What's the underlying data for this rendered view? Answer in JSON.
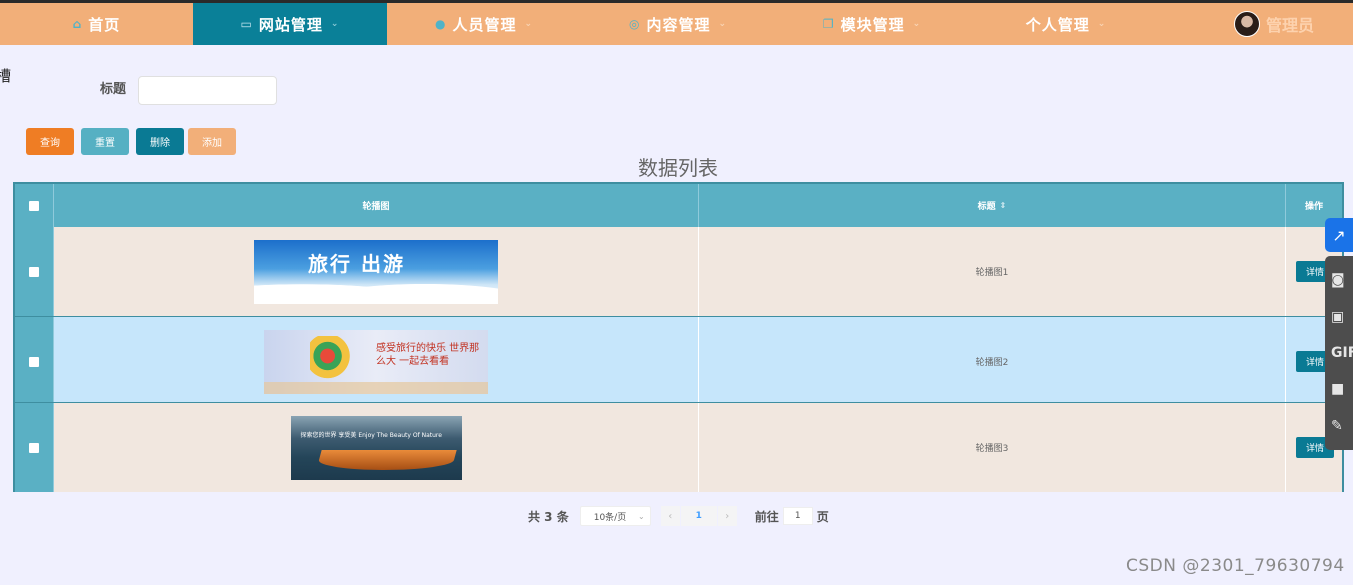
{
  "nav": {
    "items": [
      {
        "label": "首页",
        "icon": "home-icon",
        "glyph": "⌂",
        "caret": ""
      },
      {
        "label": "网站管理",
        "icon": "monitor-icon",
        "glyph": "▭",
        "caret": "⌄"
      },
      {
        "label": "人员管理",
        "icon": "user-icon",
        "glyph": "●",
        "caret": "⌄"
      },
      {
        "label": "内容管理",
        "icon": "chat-icon",
        "glyph": "◎",
        "caret": "⌄"
      },
      {
        "label": "模块管理",
        "icon": "copy-icon",
        "glyph": "❐",
        "caret": "⌄"
      },
      {
        "label": "个人管理",
        "icon": "",
        "glyph": "",
        "caret": "⌄"
      }
    ],
    "user_name": "管理员"
  },
  "corner_text": "槽",
  "search": {
    "label": "标题",
    "value": ""
  },
  "buttons": {
    "query": "查询",
    "reset": "重置",
    "delete": "删除",
    "add": "添加"
  },
  "table": {
    "title": "数据列表",
    "columns": {
      "image": "轮播图",
      "title": "标题",
      "action": "操作"
    },
    "rows": [
      {
        "banner_text": "旅行 出游",
        "title": "轮播图1",
        "action": "详情"
      },
      {
        "banner_text": "感受旅行的快乐 世界那么大 一起去看看",
        "title": "轮播图2",
        "action": "详情"
      },
      {
        "banner_text": "探索您的世界 享受美 Enjoy The Beauty Of Nature",
        "title": "轮播图3",
        "action": "详情"
      }
    ]
  },
  "pagination": {
    "total": "共 3 条",
    "page_size": "10条/页",
    "current_page": "1",
    "goto_label": "前往",
    "goto_value": "1",
    "page_suffix": "页"
  },
  "floating_toolbar": {
    "gif_label": "GIF"
  },
  "watermark": "CSDN @2301_79630794",
  "colors": {
    "nav_bg": "#f2af79",
    "nav_active": "#0a8098",
    "table_header": "#5ab0c4",
    "row_odd": "#f1e7df",
    "row_even": "#c6e6fb",
    "btn_query": "#ef7d24",
    "btn_reset": "#56b0c3",
    "btn_delete": "#0a7a94",
    "btn_add": "#f2af79"
  }
}
